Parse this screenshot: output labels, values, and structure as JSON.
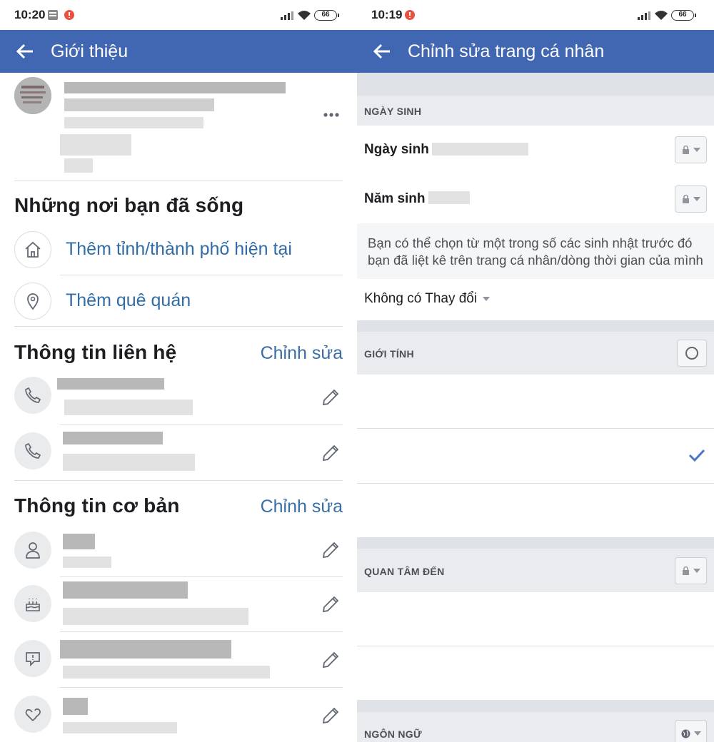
{
  "left": {
    "status": {
      "time": "10:20",
      "battery": "66"
    },
    "header": {
      "title": "Giới thiệu"
    },
    "places": {
      "title": "Những nơi bạn đã sống",
      "add_city": "Thêm tỉnh/thành phố hiện tại",
      "add_hometown": "Thêm quê quán"
    },
    "contact": {
      "title": "Thông tin liên hệ",
      "edit": "Chỉnh sửa"
    },
    "basic": {
      "title": "Thông tin cơ bản",
      "edit": "Chỉnh sửa"
    }
  },
  "right": {
    "status": {
      "time": "10:19",
      "battery": "66"
    },
    "header": {
      "title": "Chỉnh sửa trang cá nhân"
    },
    "birthday": {
      "section": "NGÀY SINH",
      "day_label": "Ngày sinh",
      "year_label": "Năm sinh",
      "note": "Bạn có thể chọn từ một trong số các sinh nhật trước đó bạn đã liệt kê trên trang cá nhân/dòng thời gian của mình",
      "change_option": "Không có Thay đổi"
    },
    "gender": {
      "section": "GIỚI TÍNH"
    },
    "interested": {
      "section": "QUAN TÂM ĐẾN"
    },
    "language": {
      "section": "NGÔN NGỮ"
    }
  },
  "colors": {
    "header_blue": "#4267b2",
    "link_blue": "#2f6ca8",
    "check_blue": "#4a76c9"
  }
}
